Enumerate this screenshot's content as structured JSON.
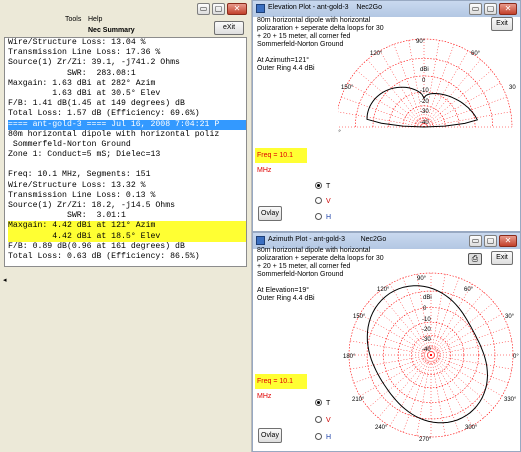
{
  "summary": {
    "menu": [
      "Tools",
      "Help"
    ],
    "title": "Nec Summary",
    "exit_label": "eXit",
    "lines": [
      {
        "t": "Wire/Structure Loss: 13.04 %"
      },
      {
        "t": "Transmission Line Loss: 17.36 %"
      },
      {
        "t": "Source(1) Zr/Zi: 39.1, -j741.2 Ohms"
      },
      {
        "t": "            SWR:  283.08:1"
      },
      {
        "t": "Maxgain: 1.63 dBi at 282° Azim"
      },
      {
        "t": "         1.63 dBi at 30.5° Elev"
      },
      {
        "t": "F/B: 1.41 dB(1.45 at 149 degrees) dB"
      },
      {
        "t": "Total Loss: 1.57 dB (Efficiency: 69.6%)"
      },
      {
        "t": "==== ant-gold-3 ==== Jul 16, 2008 7:04:21 P",
        "style": "sel"
      },
      {
        "t": "80m horizontal dipole with horizontal poliz"
      },
      {
        "t": " Sommerfeld-Norton Ground"
      },
      {
        "t": "Zone 1: Conduct=5 mS; Dielec=13"
      },
      {
        "t": ""
      },
      {
        "t": "Freq: 10.1 MHz, Segments: 151"
      },
      {
        "t": "Wire/Structure Loss: 13.32 %"
      },
      {
        "t": "Transmission Line Loss: 0.13 %"
      },
      {
        "t": "Source(1) Zr/Zi: 18.2, -j14.5 Ohms"
      },
      {
        "t": "            SWR:  3.01:1"
      },
      {
        "t": "Maxgain: 4.42 dBi at 121° Azim",
        "style": "hl"
      },
      {
        "t": "         4.42 dBi at 18.5° Elev",
        "style": "hl"
      },
      {
        "t": "F/B: 0.89 dB(0.96 at 161 degrees) dB"
      },
      {
        "t": "Total Loss: 0.63 dB (Efficiency: 86.5%)"
      }
    ]
  },
  "elevation": {
    "title": "Elevation Plot - ant-gold-3    Nec2Go",
    "exit_label": "Exit",
    "description": [
      "80m horizontal dipole with horizontal",
      "polizaration + seperate delta loops for 30",
      "+ 20 + 15 meter, all corner fed",
      "Sommerfeld-Norton Ground"
    ],
    "info": [
      "At Azimuth=121°",
      "Outer Ring 4.4 dBi"
    ],
    "freq": "Freq = 10.1 MHz",
    "angle_labels": [
      "90°",
      "120°",
      "60°",
      "150°",
      "30",
      "0°"
    ],
    "ring_labels": [
      "dBi",
      "0",
      "-10",
      "-20",
      "-30",
      "-40"
    ],
    "radio": [
      {
        "label": "T",
        "checked": true
      },
      {
        "label": "V",
        "checked": false
      },
      {
        "label": "H",
        "checked": false
      }
    ],
    "overlay_label": "Ovlay"
  },
  "azimuth": {
    "title": "Azimuth Plot - ant-gold-3        Nec2Go",
    "exit_label": "Exit",
    "description": [
      "80m horizontal dipole with horizontal",
      "polizaration + seperate delta loops for 30",
      "+ 20 + 15 meter, all corner fed",
      "Sommerfeld-Norton Ground"
    ],
    "info": [
      "At Elevation=19°",
      "Outer Ring 4.4 dBi"
    ],
    "freq": "Freq = 10.1 MHz",
    "angle_labels": [
      "90°",
      "120°",
      "60°",
      "150°",
      "30°",
      "180°",
      "0°",
      "210°",
      "330°",
      "240°",
      "300°",
      "270°"
    ],
    "ring_labels": [
      "dBi",
      "0",
      "-10",
      "-20",
      "-30",
      "-40"
    ],
    "radio": [
      {
        "label": "T",
        "checked": true
      },
      {
        "label": "V",
        "checked": false
      },
      {
        "label": "H",
        "checked": false
      }
    ],
    "overlay_label": "Ovlay"
  },
  "colors": {
    "grid": "#ff0000",
    "pattern": "#000000",
    "highlight": "#ffff33",
    "selection": "#3399ff",
    "freq_text": "#e00000"
  }
}
